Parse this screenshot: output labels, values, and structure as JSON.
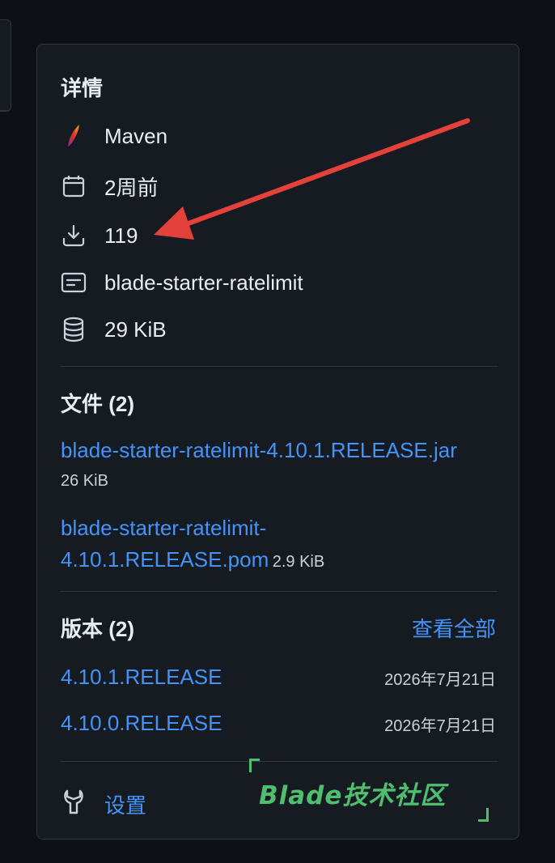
{
  "details": {
    "heading": "详情",
    "items": [
      {
        "icon": "maven-feather-icon",
        "text": "Maven"
      },
      {
        "icon": "calendar-icon",
        "text": "2周前"
      },
      {
        "icon": "download-icon",
        "text": "119"
      },
      {
        "icon": "package-card-icon",
        "text": "blade-starter-ratelimit"
      },
      {
        "icon": "database-icon",
        "text": "29 KiB"
      }
    ]
  },
  "files": {
    "heading": "文件 (2)",
    "items": [
      {
        "name": "blade-starter-ratelimit-4.10.1.RELEASE.jar",
        "size": "26 KiB"
      },
      {
        "name_line1": "blade-starter-ratelimit-",
        "name_line2": "4.10.1.RELEASE.pom",
        "size": "2.9 KiB"
      }
    ]
  },
  "versions": {
    "heading": "版本 (2)",
    "view_all": "查看全部",
    "items": [
      {
        "name": "4.10.1.RELEASE",
        "date": "2026年7月21日"
      },
      {
        "name": "4.10.0.RELEASE",
        "date": "2026年7月21日"
      }
    ]
  },
  "settings": {
    "label": "设置",
    "icon": "wrench-icon"
  },
  "watermark": {
    "text": "Blade技术社区"
  },
  "colors": {
    "accent": "#4493f8",
    "background": "#0d1117",
    "card": "#161b22",
    "border": "#30363d",
    "annotation_arrow": "#e5413b",
    "watermark": "#4fbf6f"
  }
}
